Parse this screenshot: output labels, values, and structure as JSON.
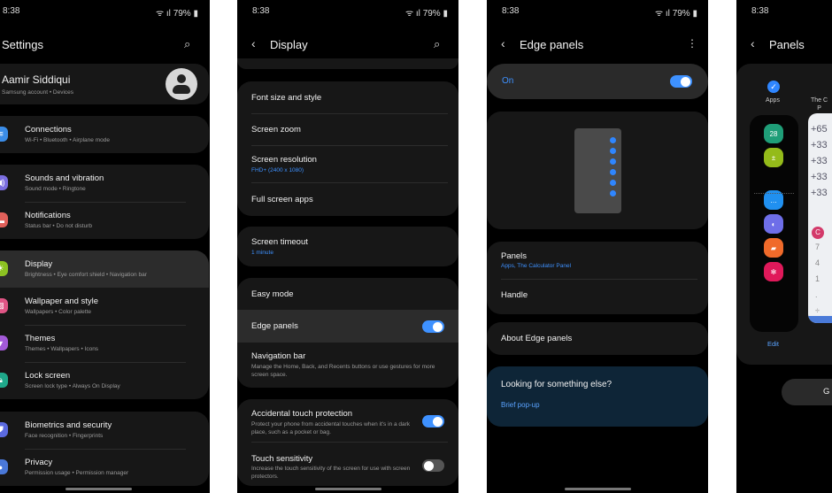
{
  "status": {
    "time": "8:38",
    "battery": "79%"
  },
  "settings": {
    "title": "Settings",
    "profile": {
      "name": "Aamir Siddiqui",
      "sub": "Samsung account  •  Devices"
    },
    "items": [
      {
        "label": "Connections",
        "sub": "Wi-Fi  •  Bluetooth  •  Airplane mode",
        "icon": "wifi-icon",
        "color": "#3b8de8"
      },
      {
        "label": "Sounds and vibration",
        "sub": "Sound mode  •  Ringtone",
        "icon": "volume-icon",
        "color": "#7b6ee0"
      },
      {
        "label": "Notifications",
        "sub": "Status bar  •  Do not disturb",
        "icon": "notification-icon",
        "color": "#e0605a"
      },
      {
        "label": "Display",
        "sub": "Brightness  •  Eye comfort shield  •  Navigation bar",
        "icon": "brightness-icon",
        "color": "#8cc222"
      },
      {
        "label": "Wallpaper and style",
        "sub": "Wallpapers  •  Color palette",
        "icon": "wallpaper-icon",
        "color": "#e05585"
      },
      {
        "label": "Themes",
        "sub": "Themes  •  Wallpapers  •  Icons",
        "icon": "themes-icon",
        "color": "#a35ad8"
      },
      {
        "label": "Lock screen",
        "sub": "Screen lock type  •  Always On Display",
        "icon": "lock-icon",
        "color": "#1fa88a"
      },
      {
        "label": "Biometrics and security",
        "sub": "Face recognition  •  Fingerprints",
        "icon": "shield-icon",
        "color": "#5b6ae0"
      },
      {
        "label": "Privacy",
        "sub": "Permission usage  •  Permission manager",
        "icon": "privacy-icon",
        "color": "#4a78d8"
      }
    ]
  },
  "display": {
    "title": "Display",
    "font_size": "Font size and style",
    "screen_zoom": "Screen zoom",
    "resolution": "Screen resolution",
    "resolution_value": "FHD+ (2400 x 1080)",
    "full_screen": "Full screen apps",
    "timeout": "Screen timeout",
    "timeout_value": "1 minute",
    "easy_mode": "Easy mode",
    "edge_panels": "Edge panels",
    "edge_panels_on": true,
    "nav_bar": "Navigation bar",
    "nav_bar_sub": "Manage the Home, Back, and Recents buttons or use gestures for more screen space.",
    "accidental": "Accidental touch protection",
    "accidental_sub": "Protect your phone from accidental touches when it's in a dark place, such as a pocket or bag.",
    "accidental_on": true,
    "touch": "Touch sensitivity",
    "touch_sub": "Increase the touch sensitivity of the screen for use with screen protectors.",
    "touch_on": false
  },
  "edge": {
    "title": "Edge panels",
    "on_label": "On",
    "on": true,
    "panels": "Panels",
    "panels_sub": "Apps, The Calculator Panel",
    "handle": "Handle",
    "about": "About Edge panels",
    "suggest_title": "Looking for something else?",
    "suggest_link": "Brief pop-up"
  },
  "panels": {
    "title": "Panels",
    "apps_label": "Apps",
    "calc_label_partial": "The C\nP",
    "edit": "Edit",
    "button_partial": "G",
    "calc_rows": [
      "+65",
      "+33",
      "+33",
      "+33",
      "+33"
    ],
    "calc_keys": [
      "C",
      "7",
      "4",
      "1",
      ".",
      "÷"
    ],
    "app_icons": [
      {
        "name": "calendar-icon",
        "color": "#1f9e78",
        "glyph": "28"
      },
      {
        "name": "calculator-icon",
        "color": "#94bb1a",
        "glyph": "±"
      },
      {
        "name": "messages-icon",
        "color": "#2090f0",
        "glyph": "…"
      },
      {
        "name": "internet-icon",
        "color": "#6e6ee8",
        "glyph": "◐"
      },
      {
        "name": "notes-icon",
        "color": "#f06a2a",
        "glyph": "▰"
      },
      {
        "name": "flower-icon",
        "color": "#e0195a",
        "glyph": "✻"
      }
    ]
  }
}
